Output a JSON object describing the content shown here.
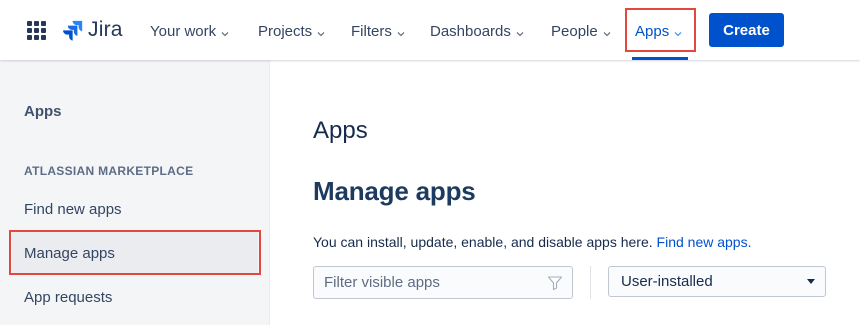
{
  "nav": {
    "logo_text": "Jira",
    "items": [
      {
        "label": "Your work"
      },
      {
        "label": "Projects"
      },
      {
        "label": "Filters"
      },
      {
        "label": "Dashboards"
      },
      {
        "label": "People"
      },
      {
        "label": "Apps"
      }
    ],
    "create_label": "Create",
    "active_item": "Apps"
  },
  "sidebar": {
    "title": "Apps",
    "section_label": "ATLASSIAN MARKETPLACE",
    "items": [
      {
        "label": "Find new apps"
      },
      {
        "label": "Manage apps"
      },
      {
        "label": "App requests"
      }
    ],
    "active_item": "Manage apps"
  },
  "main": {
    "heading": "Apps",
    "subheading": "Manage apps",
    "description": "You can install, update, enable, and disable apps here.",
    "description_link": "Find new apps.",
    "filter_placeholder": "Filter visible apps",
    "select_value": "User-installed"
  },
  "colors": {
    "brand": "#0052cc",
    "highlight": "#e2483d",
    "sidebar_bg": "#f4f5f7"
  },
  "icons": [
    "app-switcher-icon",
    "jira-logo-icon",
    "chevron-down-icon",
    "filter-funnel-icon",
    "caret-down-icon"
  ]
}
